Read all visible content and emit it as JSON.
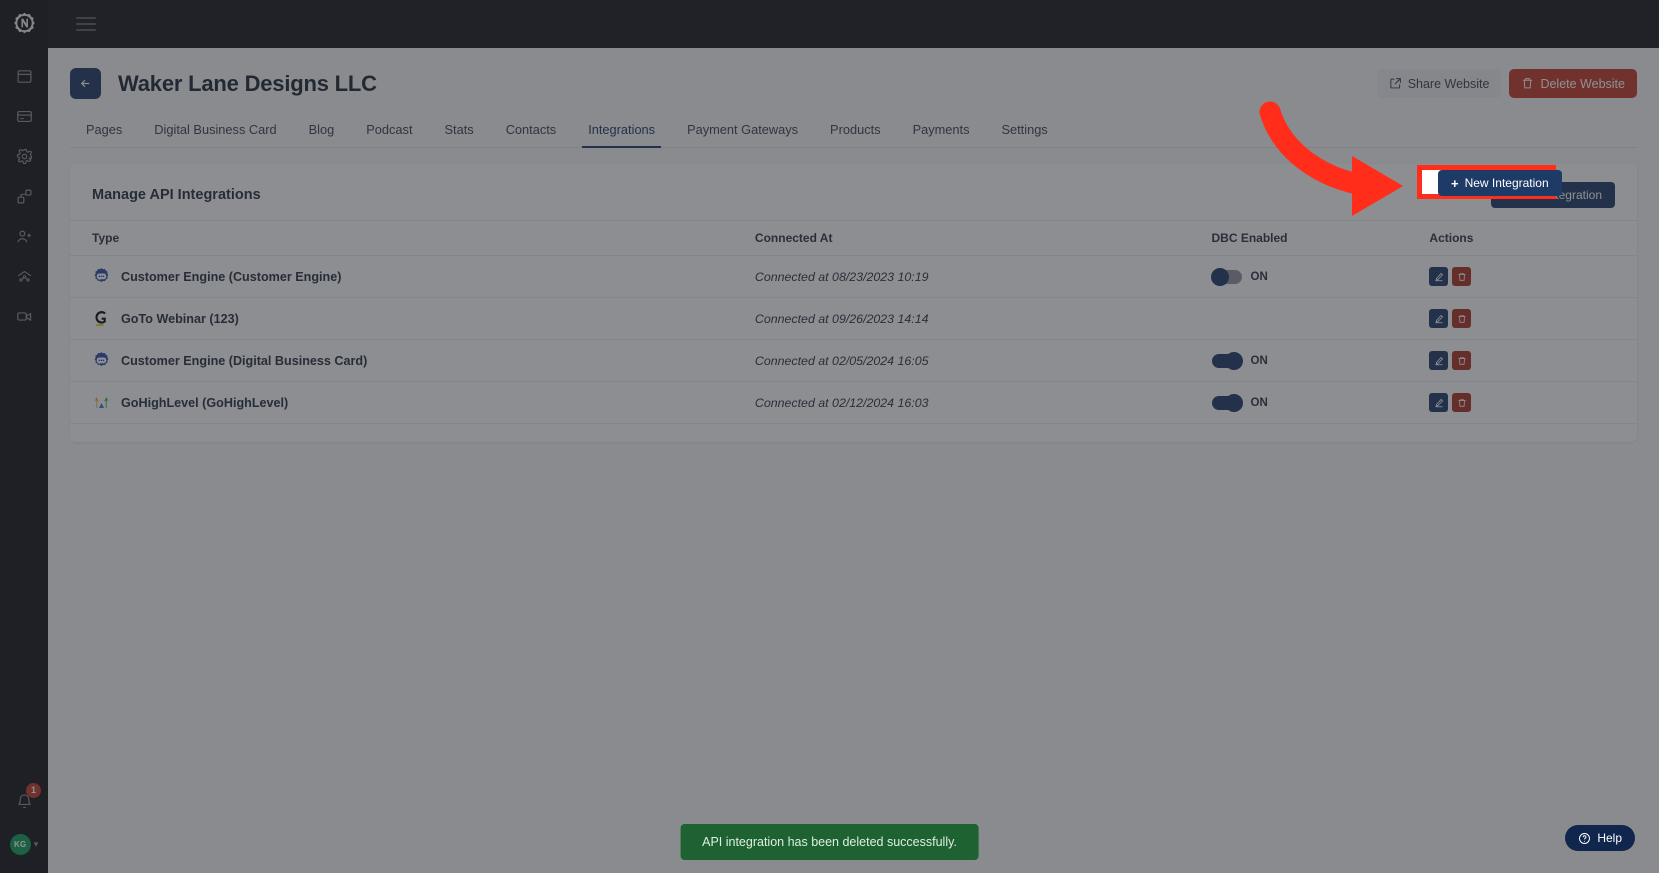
{
  "app": {
    "logo_icon": "nexus-gear-logo",
    "hamburger_icon": "hamburger-menu-icon"
  },
  "sidebar": {
    "items": [
      {
        "name": "sidebar-item-websites",
        "icon": "browser-window-icon"
      },
      {
        "name": "sidebar-item-cards",
        "icon": "credit-card-icon"
      },
      {
        "name": "sidebar-item-settings",
        "icon": "gear-icon"
      },
      {
        "name": "sidebar-item-integrations",
        "icon": "puzzle-nodes-icon"
      },
      {
        "name": "sidebar-item-add-user",
        "icon": "user-plus-icon"
      },
      {
        "name": "sidebar-item-network",
        "icon": "network-share-icon"
      },
      {
        "name": "sidebar-item-video",
        "icon": "video-camera-icon"
      }
    ],
    "notifications": {
      "icon": "bell-icon",
      "badge": "1"
    },
    "account": {
      "avatar_initials": "KG",
      "caret_icon": "chevron-down-icon"
    }
  },
  "header": {
    "back_icon": "arrow-left-icon",
    "title": "Waker Lane Designs LLC",
    "share_label": "Share Website",
    "share_icon": "share-icon",
    "delete_label": "Delete Website",
    "delete_icon": "trash-icon"
  },
  "tabs": [
    {
      "label": "Pages",
      "active": false
    },
    {
      "label": "Digital Business Card",
      "active": false
    },
    {
      "label": "Blog",
      "active": false
    },
    {
      "label": "Podcast",
      "active": false
    },
    {
      "label": "Stats",
      "active": false
    },
    {
      "label": "Contacts",
      "active": false
    },
    {
      "label": "Integrations",
      "active": true
    },
    {
      "label": "Payment Gateways",
      "active": false
    },
    {
      "label": "Products",
      "active": false
    },
    {
      "label": "Payments",
      "active": false
    },
    {
      "label": "Settings",
      "active": false
    }
  ],
  "card": {
    "title": "Manage API Integrations",
    "new_integration_label": "New Integration",
    "new_integration_plus": "+"
  },
  "table": {
    "columns": [
      "Type",
      "Connected At",
      "DBC Enabled",
      "Actions"
    ],
    "rows": [
      {
        "icon": "customer-engine-icon",
        "type": "Customer Engine (Customer Engine)",
        "connected_at": "Connected at 08/23/2023 10:19",
        "dbc_visible": true,
        "dbc_state": "off-position",
        "dbc_label": "ON",
        "edit_icon": "edit-pencil-icon",
        "delete_icon": "trash-icon"
      },
      {
        "icon": "goto-webinar-icon",
        "type": "GoTo Webinar (123)",
        "connected_at": "Connected at 09/26/2023 14:14",
        "dbc_visible": false,
        "dbc_state": "",
        "dbc_label": "",
        "edit_icon": "edit-pencil-icon",
        "delete_icon": "trash-icon"
      },
      {
        "icon": "customer-engine-icon",
        "type": "Customer Engine (Digital Business Card)",
        "connected_at": "Connected at 02/05/2024 16:05",
        "dbc_visible": true,
        "dbc_state": "on-position",
        "dbc_label": "ON",
        "edit_icon": "edit-pencil-icon",
        "delete_icon": "trash-icon"
      },
      {
        "icon": "gohighlevel-icon",
        "type": "GoHighLevel (GoHighLevel)",
        "connected_at": "Connected at 02/12/2024 16:03",
        "dbc_visible": true,
        "dbc_state": "on-position",
        "dbc_label": "ON",
        "edit_icon": "edit-pencil-icon",
        "delete_icon": "trash-icon"
      }
    ]
  },
  "toast": {
    "message": "API integration has been deleted successfully."
  },
  "help": {
    "label": "Help",
    "icon": "question-circle-icon"
  },
  "annotation": {
    "arrow_color": "#ff2d1a",
    "highlight_color": "#ff2d1a",
    "target": "New Integration"
  },
  "colors": {
    "accent": "#1e3a66",
    "danger": "#c0392b",
    "success": "#1d6230",
    "rail": "#14161c",
    "topbar": "#171a21"
  }
}
